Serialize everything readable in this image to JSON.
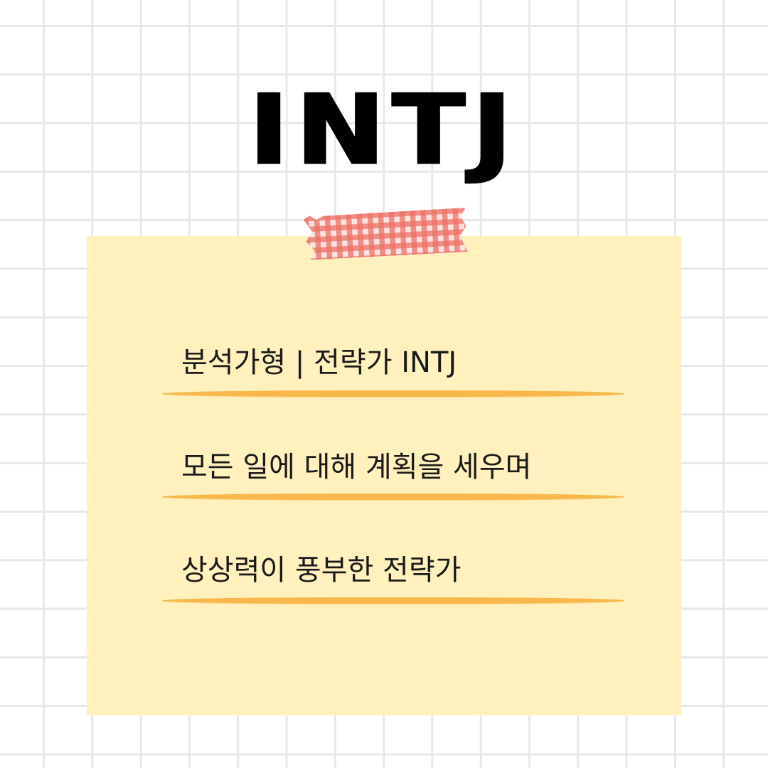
{
  "title": "INTJ",
  "lines": [
    "분석가형 | 전략가 INTJ",
    "모든 일에 대해 계획을 세우며",
    "상상력이 풍부한 전략가"
  ],
  "colors": {
    "note_background": "#fff0be",
    "underline": "#f7b13e",
    "tape_check": "#ee7064",
    "grid_line": "#e4eae9"
  }
}
